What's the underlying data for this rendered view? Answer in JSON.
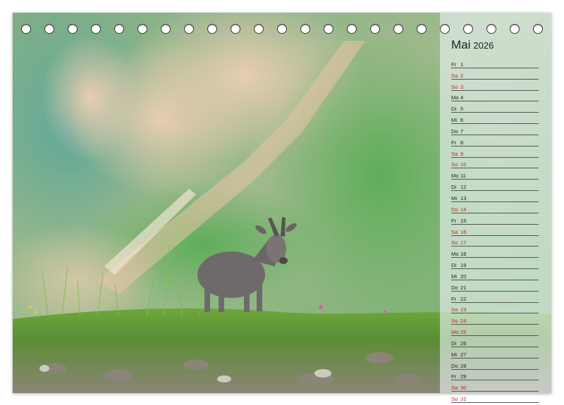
{
  "calendar": {
    "month": "Mai",
    "year": "2026",
    "weekend_color": "#c0261f",
    "days": [
      {
        "wd": "Fr",
        "n": "1",
        "we": false
      },
      {
        "wd": "Sa",
        "n": "2",
        "we": true
      },
      {
        "wd": "So",
        "n": "3",
        "we": true
      },
      {
        "wd": "Mo",
        "n": "4",
        "we": false
      },
      {
        "wd": "Di",
        "n": "5",
        "we": false
      },
      {
        "wd": "Mi",
        "n": "6",
        "we": false
      },
      {
        "wd": "Do",
        "n": "7",
        "we": false
      },
      {
        "wd": "Fr",
        "n": "8",
        "we": false
      },
      {
        "wd": "Sa",
        "n": "9",
        "we": true
      },
      {
        "wd": "So",
        "n": "10",
        "we": true
      },
      {
        "wd": "Mo",
        "n": "11",
        "we": false
      },
      {
        "wd": "Di",
        "n": "12",
        "we": false
      },
      {
        "wd": "Mi",
        "n": "13",
        "we": false
      },
      {
        "wd": "Do",
        "n": "14",
        "we": true
      },
      {
        "wd": "Fr",
        "n": "15",
        "we": false
      },
      {
        "wd": "Sa",
        "n": "16",
        "we": true
      },
      {
        "wd": "So",
        "n": "17",
        "we": true
      },
      {
        "wd": "Mo",
        "n": "18",
        "we": false
      },
      {
        "wd": "Di",
        "n": "19",
        "we": false
      },
      {
        "wd": "Mi",
        "n": "20",
        "we": false
      },
      {
        "wd": "Do",
        "n": "21",
        "we": false
      },
      {
        "wd": "Fr",
        "n": "22",
        "we": false
      },
      {
        "wd": "Sa",
        "n": "23",
        "we": true
      },
      {
        "wd": "So",
        "n": "24",
        "we": true
      },
      {
        "wd": "Mo",
        "n": "25",
        "we": true
      },
      {
        "wd": "Di",
        "n": "26",
        "we": false
      },
      {
        "wd": "Mi",
        "n": "27",
        "we": false
      },
      {
        "wd": "Do",
        "n": "28",
        "we": false
      },
      {
        "wd": "Fr",
        "n": "29",
        "we": false
      },
      {
        "wd": "Sa",
        "n": "30",
        "we": true
      },
      {
        "wd": "So",
        "n": "31",
        "we": true
      }
    ]
  },
  "binding": {
    "hole_count": 23
  }
}
